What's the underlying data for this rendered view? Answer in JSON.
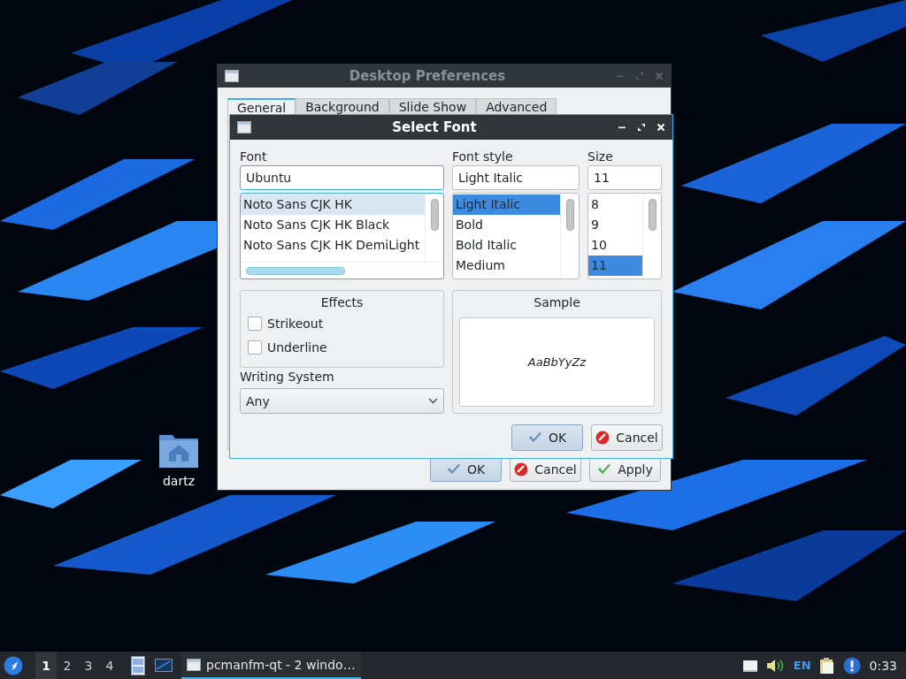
{
  "desktop_icons": [
    {
      "label": "dartz"
    }
  ],
  "back_window": {
    "title": "Desktop Preferences",
    "tabs": [
      {
        "label": "General",
        "selected": true
      },
      {
        "label": "Background",
        "selected": false
      },
      {
        "label": "Slide Show",
        "selected": false
      },
      {
        "label": "Advanced",
        "selected": false
      }
    ],
    "buttons": [
      {
        "label": "OK",
        "kind": "ok",
        "default": true
      },
      {
        "label": "Cancel",
        "kind": "cancel",
        "default": false
      },
      {
        "label": "Apply",
        "kind": "apply",
        "default": false
      }
    ]
  },
  "dialog": {
    "title": "Select Font",
    "columns": [
      {
        "label": "Font",
        "value": "Ubuntu",
        "focused": true,
        "items": [
          {
            "label": "Noto Sans CJK HK",
            "selected": true
          },
          {
            "label": "Noto Sans CJK HK Black",
            "selected": false
          },
          {
            "label": "Noto Sans CJK HK DemiLight",
            "selected": false
          }
        ]
      },
      {
        "label": "Font style",
        "value": "Light Italic",
        "focused": false,
        "items": [
          {
            "label": "Light Italic",
            "selected": true
          },
          {
            "label": "Bold",
            "selected": false
          },
          {
            "label": "Bold Italic",
            "selected": false
          },
          {
            "label": "Medium",
            "selected": false
          }
        ]
      },
      {
        "label": "Size",
        "value": "11",
        "focused": false,
        "items": [
          {
            "label": "8",
            "selected": false
          },
          {
            "label": "9",
            "selected": false
          },
          {
            "label": "10",
            "selected": false
          },
          {
            "label": "11",
            "selected": true
          }
        ]
      }
    ],
    "effects": {
      "title": "Effects",
      "options": [
        {
          "label": "Strikeout",
          "checked": false
        },
        {
          "label": "Underline",
          "checked": false
        }
      ]
    },
    "writing_system": {
      "label": "Writing System",
      "value": "Any"
    },
    "sample": {
      "title": "Sample",
      "text": "AaBbYyZz"
    },
    "buttons": [
      {
        "label": "OK",
        "kind": "ok",
        "default": true
      },
      {
        "label": "Cancel",
        "kind": "cancel",
        "default": false
      }
    ]
  },
  "taskbar": {
    "desktops": [
      {
        "label": "1",
        "selected": true
      },
      {
        "label": "2",
        "selected": false
      },
      {
        "label": "3",
        "selected": false
      },
      {
        "label": "4",
        "selected": false
      }
    ],
    "tasks": [
      {
        "label": "pcmanfm-qt - 2 windo…",
        "selected": true
      }
    ],
    "tray": [
      {
        "kind": "drive"
      },
      {
        "kind": "volume"
      },
      {
        "kind": "text",
        "label": "EN"
      },
      {
        "kind": "clipboard"
      },
      {
        "kind": "info"
      }
    ],
    "clock": "0:33"
  }
}
